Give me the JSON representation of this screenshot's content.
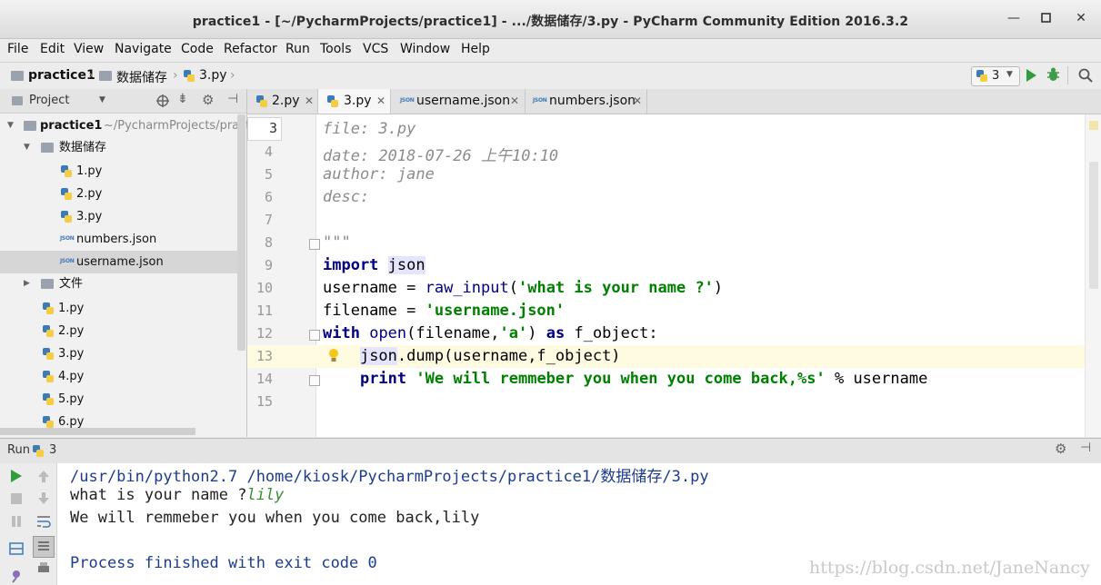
{
  "window": {
    "title": "practice1 - [~/PycharmProjects/practice1] - .../数据储存/3.py - PyCharm Community Edition 2016.3.2"
  },
  "menu": [
    "File",
    "Edit",
    "View",
    "Navigate",
    "Code",
    "Refactor",
    "Run",
    "Tools",
    "VCS",
    "Window",
    "Help"
  ],
  "breadcrumb": {
    "project": "practice1",
    "folder": "数据储存",
    "file": "3.py"
  },
  "run_config": "3",
  "project_panel": {
    "label": "Project",
    "root": "practice1",
    "root_path": "~/PycharmProjects/practice1",
    "tree": [
      {
        "label": "数据储存",
        "type": "folder"
      },
      {
        "label": "1.py",
        "type": "py"
      },
      {
        "label": "2.py",
        "type": "py"
      },
      {
        "label": "3.py",
        "type": "py"
      },
      {
        "label": "numbers.json",
        "type": "json"
      },
      {
        "label": "username.json",
        "type": "json",
        "selected": true
      },
      {
        "label": "文件",
        "type": "folder"
      },
      {
        "label": "1.py",
        "type": "py"
      },
      {
        "label": "2.py",
        "type": "py"
      },
      {
        "label": "3.py",
        "type": "py"
      },
      {
        "label": "4.py",
        "type": "py"
      },
      {
        "label": "5.py",
        "type": "py"
      },
      {
        "label": "6.py",
        "type": "py"
      }
    ]
  },
  "tabs": [
    {
      "label": "2.py",
      "active": false
    },
    {
      "label": "3.py",
      "active": true
    },
    {
      "label": "username.json",
      "active": false
    },
    {
      "label": "numbers.json",
      "active": false
    }
  ],
  "editor": {
    "line_numbers": [
      "3",
      "4",
      "5",
      "6",
      "7",
      "8",
      "9",
      "10",
      "11",
      "12",
      "13",
      "14",
      "15"
    ],
    "docstring": [
      "file: 3.py",
      "date: 2018-07-26 上午10:10",
      "author: jane",
      "desc:"
    ],
    "tokens": {
      "triple_quote": "\"\"\"",
      "import": "import",
      "json": "json",
      "username": "username",
      "eq": " = ",
      "raw_input": "raw_input",
      "prompt": "'what is your name ?'",
      "filename": "filename",
      "filename_val": "'username.json'",
      "with": "with",
      "open": "open",
      "open_args_a": "(filename,",
      "mode": "'a'",
      "open_args_b": ")",
      "as": "as",
      "f_object": "f_object:",
      "dump_call": ".dump(username,f_object)",
      "print": "print",
      "print_str": "'We will remmeber you when you come back,%s'",
      "print_rest": " % username",
      "paren_open": "(",
      "paren_close": ")"
    }
  },
  "run_panel": {
    "label": "Run",
    "config": "3"
  },
  "console": {
    "command": "/usr/bin/python2.7 /home/kiosk/PycharmProjects/practice1/数据储存/3.py",
    "prompt": "what is your name ?",
    "input": "lily",
    "output": "We will remmeber you when you come back,lily",
    "exit": "Process finished with exit code 0"
  },
  "watermark": "https://blog.csdn.net/JaneNancy",
  "colors": {
    "keyword": "#000080",
    "string": "#008000",
    "comment": "#8c8c8c",
    "console_cmd": "#1d3c8c",
    "console_input": "#3a8e3a"
  }
}
